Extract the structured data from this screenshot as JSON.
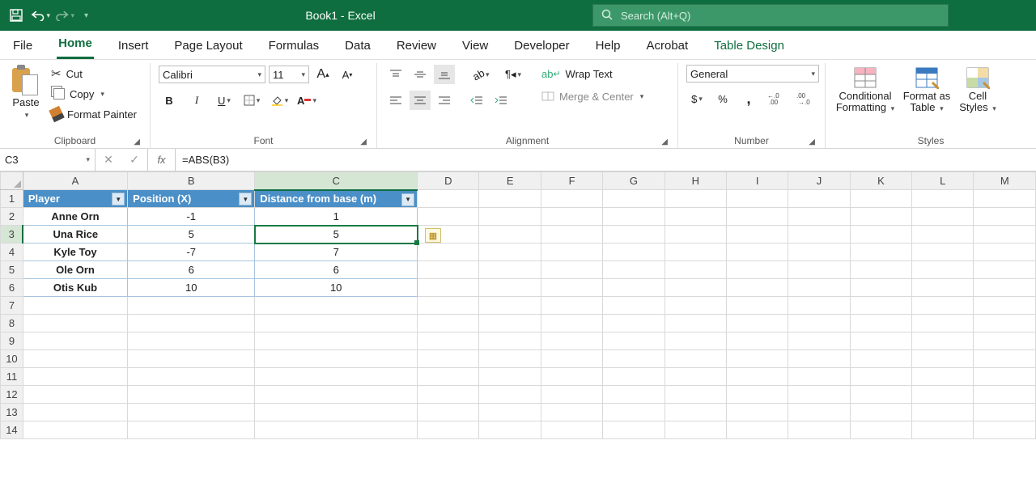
{
  "app": {
    "title": "Book1  -  Excel",
    "search_placeholder": "Search (Alt+Q)"
  },
  "qat": {
    "save": "save-icon",
    "undo": "undo-icon",
    "redo": "redo-icon"
  },
  "tabs": {
    "items": [
      "File",
      "Home",
      "Insert",
      "Page Layout",
      "Formulas",
      "Data",
      "Review",
      "View",
      "Developer",
      "Help",
      "Acrobat"
    ],
    "context": "Table Design",
    "active": "Home"
  },
  "ribbon": {
    "clipboard": {
      "label": "Clipboard",
      "paste": "Paste",
      "cut": "Cut",
      "copy": "Copy",
      "format_painter": "Format Painter"
    },
    "font": {
      "label": "Font",
      "name": "Calibri",
      "size": "11"
    },
    "alignment": {
      "label": "Alignment",
      "wrap": "Wrap Text",
      "merge": "Merge & Center"
    },
    "number": {
      "label": "Number",
      "format": "General"
    },
    "styles": {
      "label": "Styles",
      "conditional": "Conditional Formatting",
      "format_as": "Format as Table",
      "cell": "Cell Styles"
    }
  },
  "formula_bar": {
    "name_box": "C3",
    "formula": "=ABS(B3)"
  },
  "columns": [
    "A",
    "B",
    "C",
    "D",
    "E",
    "F",
    "G",
    "H",
    "I",
    "J",
    "K",
    "L",
    "M"
  ],
  "table": {
    "headers": [
      "Player",
      "Position (X)",
      "Distance from base (m)"
    ],
    "rows": [
      {
        "player": "Anne Orn",
        "pos": "-1",
        "dist": "1"
      },
      {
        "player": "Una Rice",
        "pos": "5",
        "dist": "5"
      },
      {
        "player": "Kyle Toy",
        "pos": "-7",
        "dist": "7"
      },
      {
        "player": "Ole Orn",
        "pos": "6",
        "dist": "6"
      },
      {
        "player": "Otis Kub",
        "pos": "10",
        "dist": "10"
      }
    ]
  },
  "glyphs": {
    "currency": "$",
    "percent": "%",
    "comma": ",",
    "inc_dec": "←.0 .00",
    "dec_dec": ".00 →.0"
  }
}
